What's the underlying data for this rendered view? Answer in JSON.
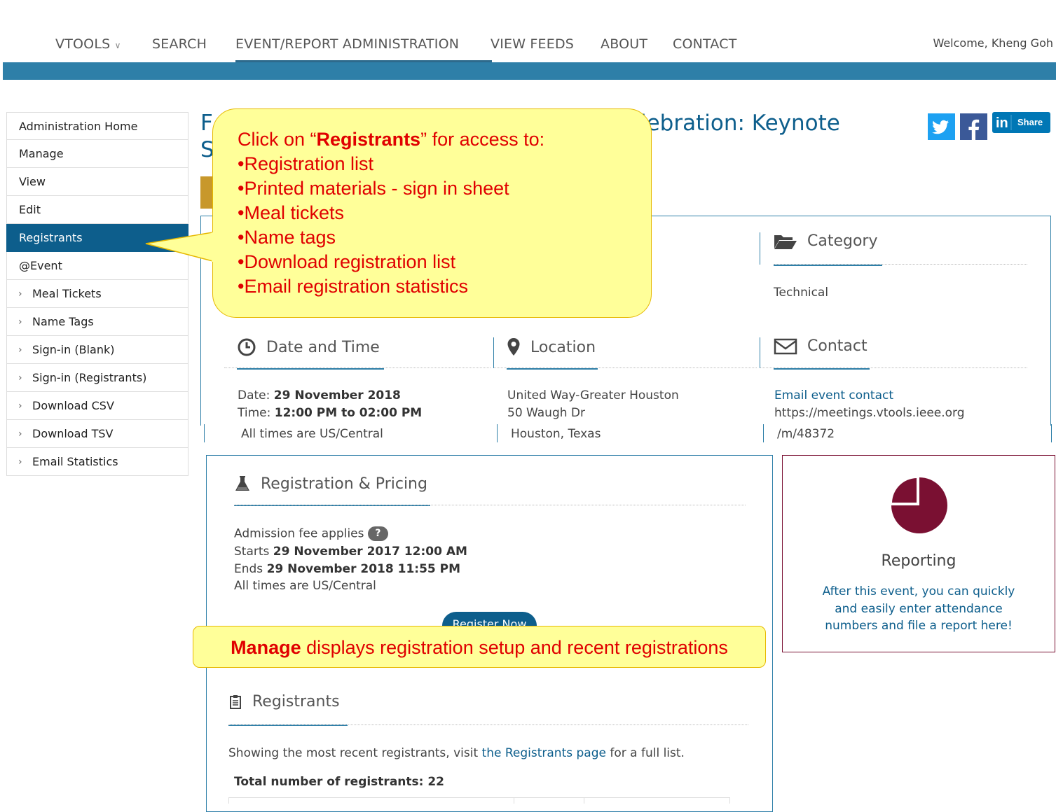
{
  "nav": {
    "vtools": "VTOOLS",
    "search": "SEARCH",
    "event_admin": "EVENT/REPORT ADMINISTRATION",
    "view_feeds": "VIEW FEEDS",
    "about": "ABOUT",
    "contact": "CONTACT",
    "welcome": "Welcome, Kheng Goh"
  },
  "sidebar": {
    "items": [
      {
        "label": "Administration Home"
      },
      {
        "label": "Manage"
      },
      {
        "label": "View"
      },
      {
        "label": "Edit"
      },
      {
        "label": "Registrants"
      },
      {
        "label": "@Event"
      },
      {
        "label": "Meal Tickets"
      },
      {
        "label": "Name Tags"
      },
      {
        "label": "Sign-in (Blank)"
      },
      {
        "label": "Sign-in (Registrants)"
      },
      {
        "label": "Download CSV"
      },
      {
        "label": "Download TSV"
      },
      {
        "label": "Email Statistics"
      }
    ]
  },
  "title": {
    "line1_start": "F",
    "line1_end": "lebration: Keynote",
    "line2_start": "S"
  },
  "social": {
    "share": "Share"
  },
  "category": {
    "heading": "Category",
    "value": "Technical"
  },
  "datetime": {
    "heading": "Date and Time",
    "date_label": "Date: ",
    "date": "29 November 2018",
    "time_label": "Time: ",
    "time": "12:00 PM to 02:00 PM",
    "tz": "All times are US/Central"
  },
  "location": {
    "heading": "Location",
    "line1": "United Way-Greater Houston",
    "line2": "50 Waugh Dr",
    "line3": "Houston, Texas"
  },
  "contact": {
    "heading": "Contact",
    "email_link": "Email event contact",
    "url1": "https://meetings.vtools.ieee.org",
    "url2": "/m/48372"
  },
  "registration": {
    "heading": "Registration & Pricing",
    "fee": "Admission fee applies",
    "starts_label": "Starts ",
    "starts": "29 November 2017 12:00 AM",
    "ends_label": "Ends ",
    "ends": "29 November 2018 11:55 PM",
    "tz": "All times are US/Central",
    "button": "Register Now"
  },
  "reporting": {
    "heading": "Reporting",
    "text1": "After this event, you can quickly",
    "text2": "and easily enter attendance",
    "text3": "numbers and file a report here!"
  },
  "registrants": {
    "heading": "Registrants",
    "showing_pre": "Showing the most recent registrants, visit ",
    "showing_link": "the Registrants page",
    "showing_post": " for a full list.",
    "total": "Total number of registrants: 22"
  },
  "callout1": {
    "l1_pre": "Click on “",
    "l1_bold": "Registrants",
    "l1_post": "”  for access to:",
    "l2": "•Registration list",
    "l3": "•Printed  materials - sign in sheet",
    "l4": "•Meal tickets",
    "l5": "•Name tags",
    "l6": "•Download registration list",
    "l7": "•Email  registration statistics"
  },
  "callout2": {
    "bold": "Manage",
    "rest": " displays registration setup and recent registrations"
  },
  "colors": {
    "accent": "#0d5e8c",
    "bar": "#2e7fa8",
    "callout": "#ffff99",
    "callout_text": "#e00000",
    "report": "#7a1032"
  }
}
